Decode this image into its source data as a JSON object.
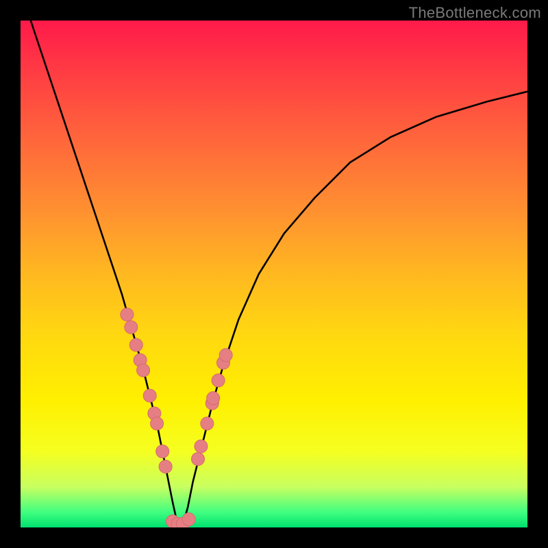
{
  "watermark": "TheBottleneck.com",
  "colors": {
    "background": "#000000",
    "curve": "#000000",
    "marker_fill": "#e57f83",
    "marker_stroke": "#d46a6e",
    "gradient_top": "#ff1a4a",
    "gradient_bottom": "#00e070"
  },
  "chart_data": {
    "type": "line",
    "title": "",
    "xlabel": "",
    "ylabel": "",
    "xlim": [
      0,
      100
    ],
    "ylim": [
      0,
      100
    ],
    "curve": {
      "x": [
        2,
        5,
        8,
        11,
        14,
        17,
        20,
        22,
        24,
        26,
        27,
        28,
        29,
        30,
        31,
        32,
        33,
        34,
        36,
        38,
        40,
        43,
        47,
        52,
        58,
        65,
        73,
        82,
        92,
        100
      ],
      "y": [
        100,
        91,
        82,
        73,
        64,
        55,
        46,
        39,
        32,
        24,
        20,
        15,
        10,
        5,
        0.5,
        0.5,
        4,
        9,
        17,
        25,
        32,
        41,
        50,
        58,
        65,
        72,
        77,
        81,
        84,
        86
      ],
      "annotation": "V-shaped bottleneck curve; minimum (optimal match) occurs near x≈31, rising steeply on the left and more gently on the right."
    },
    "markers_left": {
      "x": [
        21.0,
        21.8,
        22.8,
        23.6,
        24.2,
        25.5,
        26.4,
        26.9,
        28.0,
        28.6
      ],
      "y": [
        42.0,
        39.5,
        36.0,
        33.0,
        31.0,
        26.0,
        22.5,
        20.5,
        15.0,
        12.0
      ]
    },
    "markers_right": {
      "x": [
        35.0,
        35.6,
        36.8,
        37.8,
        38.0,
        39.0,
        40.0,
        40.5
      ],
      "y": [
        13.5,
        16.0,
        20.5,
        24.5,
        25.5,
        29.0,
        32.5,
        34.0
      ]
    },
    "markers_bottom": {
      "x": [
        30.0,
        31.0,
        32.0,
        33.2
      ],
      "y": [
        1.2,
        0.7,
        0.7,
        1.6
      ]
    }
  }
}
